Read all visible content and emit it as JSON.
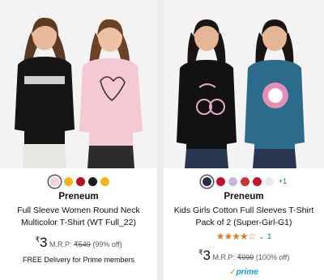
{
  "products": [
    {
      "brand": "Preneum",
      "title": "Full Sleeve Women Round Neck Multicolor T-Shirt (WT Full_22)",
      "currency": "₹",
      "price": "3",
      "mrp_label": "M.R.P:",
      "mrp_value": "₹549",
      "discount": "(99% off)",
      "delivery": "FREE Delivery for Prime members",
      "swatch_colors": [
        "#f4d2dc",
        "#f5b417",
        "#b8101f",
        "#1b1b1b",
        "#f2b51d"
      ],
      "selected_swatch": 0
    },
    {
      "brand": "Preneum",
      "title": "Kids Girls Cotton Full Sleeves T-Shirt Pack of 2 (Super-Girl-G1)",
      "currency": "₹",
      "price": "3",
      "mrp_label": "M.R.P:",
      "mrp_value": "₹999",
      "discount": "(100% off)",
      "rating_stars": "★★★★☆",
      "rating_value": 4.0,
      "rating_count": "1",
      "more_colors": "+1",
      "prime_label": "prime",
      "swatch_colors": [
        "#233043",
        "#c4132c",
        "#c7b6d6",
        "#c7343a",
        "#c4142c",
        "#e9e9ee"
      ],
      "selected_swatch": 0
    }
  ],
  "colors": {
    "link": "#007185",
    "star": "#de7921",
    "prime_blue": "#1399d6",
    "text": "#0f1111",
    "muted": "#565959"
  }
}
